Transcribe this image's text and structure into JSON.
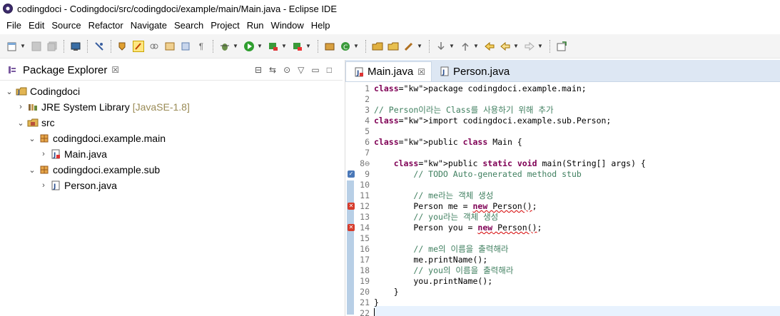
{
  "window": {
    "title": "codingdoci - Codingdoci/src/codingdoci/example/main/Main.java - Eclipse IDE"
  },
  "menu": [
    "File",
    "Edit",
    "Source",
    "Refactor",
    "Navigate",
    "Search",
    "Project",
    "Run",
    "Window",
    "Help"
  ],
  "package_explorer": {
    "title": "Package Explorer",
    "tree": [
      {
        "label": "Codingdoci",
        "decoration": "",
        "indent": 0,
        "expanded": true,
        "icon": "project-icon"
      },
      {
        "label": "JRE System Library",
        "decoration": "[JavaSE-1.8]",
        "indent": 1,
        "expanded": false,
        "icon": "library-icon"
      },
      {
        "label": "src",
        "decoration": "",
        "indent": 1,
        "expanded": true,
        "icon": "source-folder-icon"
      },
      {
        "label": "codingdoci.example.main",
        "decoration": "",
        "indent": 2,
        "expanded": true,
        "icon": "package-icon"
      },
      {
        "label": "Main.java",
        "decoration": "",
        "indent": 3,
        "expanded": false,
        "icon": "java-file-icon"
      },
      {
        "label": "codingdoci.example.sub",
        "decoration": "",
        "indent": 2,
        "expanded": true,
        "icon": "package-icon"
      },
      {
        "label": "Person.java",
        "decoration": "",
        "indent": 3,
        "expanded": false,
        "icon": "java-file-icon"
      }
    ]
  },
  "editor": {
    "tabs": [
      {
        "label": "Main.java",
        "active": true
      },
      {
        "label": "Person.java",
        "active": false
      }
    ],
    "lines": [
      {
        "n": "1",
        "text": "package codingdoci.example.main;"
      },
      {
        "n": "2",
        "text": ""
      },
      {
        "n": "3",
        "text": "// Person이라는 Class를 사용하기 위해 추가"
      },
      {
        "n": "4",
        "text": "import codingdoci.example.sub.Person;"
      },
      {
        "n": "5",
        "text": ""
      },
      {
        "n": "6",
        "text": "public class Main {"
      },
      {
        "n": "7",
        "text": ""
      },
      {
        "n": "8⊖",
        "text": "    public static void main(String[] args) {"
      },
      {
        "n": "9",
        "text": "        // TODO Auto-generated method stub"
      },
      {
        "n": "10",
        "text": ""
      },
      {
        "n": "11",
        "text": "        // me라는 객체 생성"
      },
      {
        "n": "12",
        "text": "        Person me = new Person();"
      },
      {
        "n": "13",
        "text": "        // you라는 객체 생성"
      },
      {
        "n": "14",
        "text": "        Person you = new Person();"
      },
      {
        "n": "15",
        "text": ""
      },
      {
        "n": "16",
        "text": "        // me의 이름을 출력해라"
      },
      {
        "n": "17",
        "text": "        me.printName();"
      },
      {
        "n": "18",
        "text": "        // you의 이름을 출력해라"
      },
      {
        "n": "19",
        "text": "        you.printName();"
      },
      {
        "n": "20",
        "text": "    }"
      },
      {
        "n": "21",
        "text": "}"
      },
      {
        "n": "22",
        "text": ""
      }
    ]
  },
  "colors": {
    "keyword": "#7f0055",
    "comment": "#3f7f5f",
    "tabbar": "#dde7f3",
    "error_marker": "#d63b2b"
  }
}
